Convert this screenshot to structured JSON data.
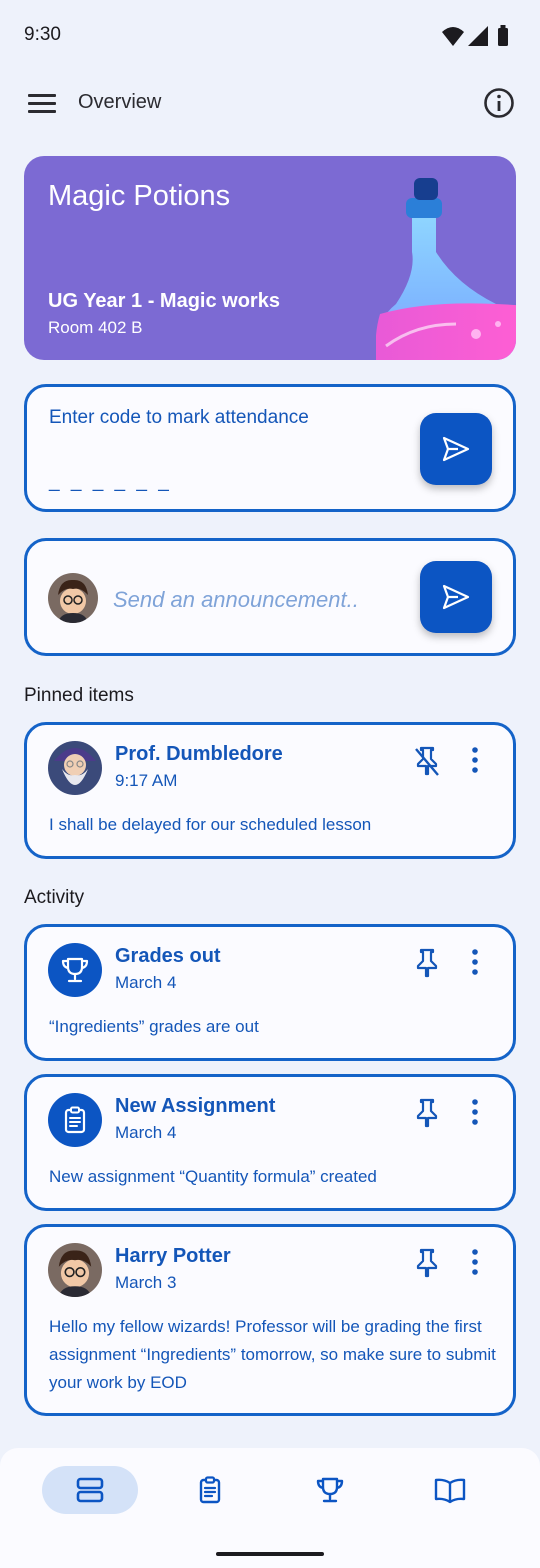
{
  "status_bar": {
    "time": "9:30"
  },
  "top_bar": {
    "title": "Overview"
  },
  "course": {
    "title": "Magic Potions",
    "subtitle": "UG Year 1 - Magic works",
    "room": "Room 402 B"
  },
  "attendance": {
    "label": "Enter code to mark attendance",
    "code_placeholder": "_ _ _ _ _ _"
  },
  "announcement": {
    "placeholder": "Send an announcement.."
  },
  "pinned": {
    "heading": "Pinned items",
    "items": [
      {
        "name": "Prof. Dumbledore",
        "time": "9:17 AM",
        "body": "I shall be delayed for our scheduled lesson"
      }
    ]
  },
  "activity": {
    "heading": "Activity",
    "items": [
      {
        "icon": "trophy-icon",
        "title": "Grades out",
        "date": "March 4",
        "body": "“Ingredients” grades are out"
      },
      {
        "icon": "clipboard-icon",
        "title": "New Assignment",
        "date": "March 4",
        "body": "New assignment “Quantity formula” created"
      },
      {
        "icon": "avatar-harry",
        "title": "Harry Potter",
        "date": "March 3",
        "body": "Hello my fellow wizards! Professor will be grading the first assignment “Ingredients” tomorrow, so make sure to submit your work by EOD"
      }
    ]
  },
  "bottom_nav": {
    "items": [
      "stream-icon",
      "assignments-icon",
      "grades-icon",
      "book-icon"
    ],
    "active": "stream-icon"
  },
  "colors": {
    "primary": "#0c55c3",
    "card_border": "#1463c8",
    "banner": "#7c6ad3",
    "background": "#eef2fb"
  }
}
